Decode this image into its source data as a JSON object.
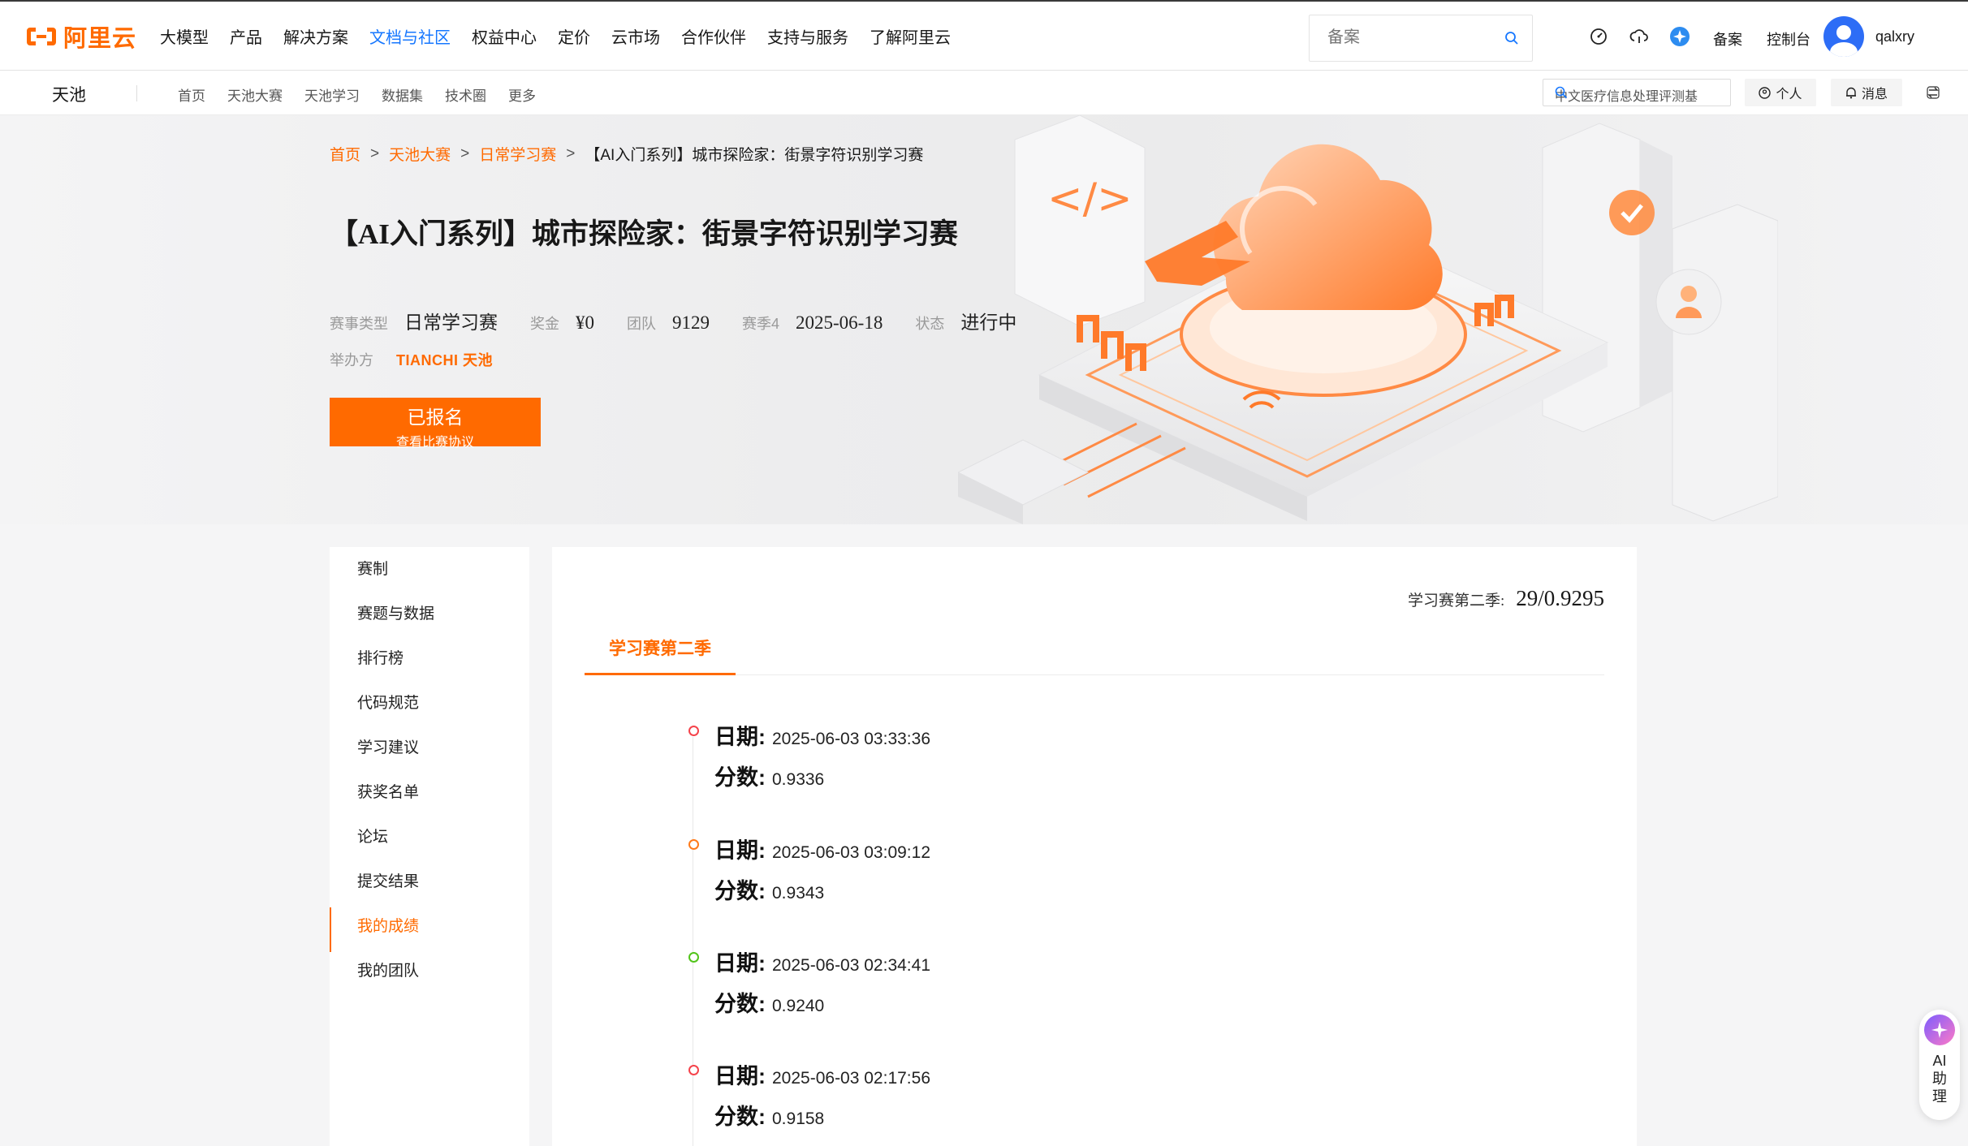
{
  "header": {
    "logo_text": "阿里云",
    "nav": [
      "大模型",
      "产品",
      "解决方案",
      "文档与社区",
      "权益中心",
      "定价",
      "云市场",
      "合作伙伴",
      "支持与服务",
      "了解阿里云"
    ],
    "active_nav": "文档与社区",
    "search_placeholder": "备案",
    "links": [
      "备案",
      "控制台"
    ],
    "username": "qalxry",
    "icons": [
      "dashboard-icon",
      "cloud-support-icon",
      "star-badge-icon"
    ]
  },
  "subheader": {
    "brand": "天池",
    "nav": [
      "首页",
      "天池大赛",
      "天池学习",
      "数据集",
      "技术圈",
      "更多"
    ],
    "search_text": "中文医疗信息处理评测基",
    "personal": "个人",
    "messages": "消息"
  },
  "banner": {
    "breadcrumb": [
      "首页",
      "天池大赛",
      "日常学习赛",
      "【AI入门系列】城市探险家：街景字符识别学习赛"
    ],
    "title": "【AI入门系列】城市探险家：街景字符识别学习赛",
    "meta": [
      {
        "key": "赛事类型",
        "value": "日常学习赛"
      },
      {
        "key": "奖金",
        "value": "¥0"
      },
      {
        "key": "团队",
        "value": "9129"
      },
      {
        "key": "赛季4",
        "value": "2025-06-18"
      },
      {
        "key": "状态",
        "value": "进行中"
      }
    ],
    "host_label": "举办方",
    "host_logo": "TIANCHI 天池",
    "enroll_button": "已报名",
    "enroll_sub": "查看比赛协议"
  },
  "sidemenu": {
    "items": [
      "赛制",
      "赛题与数据",
      "排行榜",
      "代码规范",
      "学习建议",
      "获奖名单",
      "论坛",
      "提交结果",
      "我的成绩",
      "我的团队"
    ],
    "active": "我的成绩"
  },
  "panel": {
    "season_label": "学习赛第二季:",
    "season_value": "29/0.9295",
    "tab": "学习赛第二季",
    "date_label": "日期:",
    "score_label": "分数:",
    "records": [
      {
        "date": "2025-06-03 03:33:36",
        "score": "0.9336",
        "dot_color": "#f5434b"
      },
      {
        "date": "2025-06-03 03:09:12",
        "score": "0.9343",
        "dot_color": "#ff7a1a"
      },
      {
        "date": "2025-06-03 02:34:41",
        "score": "0.9240",
        "dot_color": "#52c41a"
      },
      {
        "date": "2025-06-03 02:17:56",
        "score": "0.9158",
        "dot_color": "#f5434b"
      }
    ]
  },
  "ai_helper": {
    "label": "AI助理"
  },
  "colors": {
    "accent": "#ff6a00",
    "link_blue": "#1677ff"
  }
}
